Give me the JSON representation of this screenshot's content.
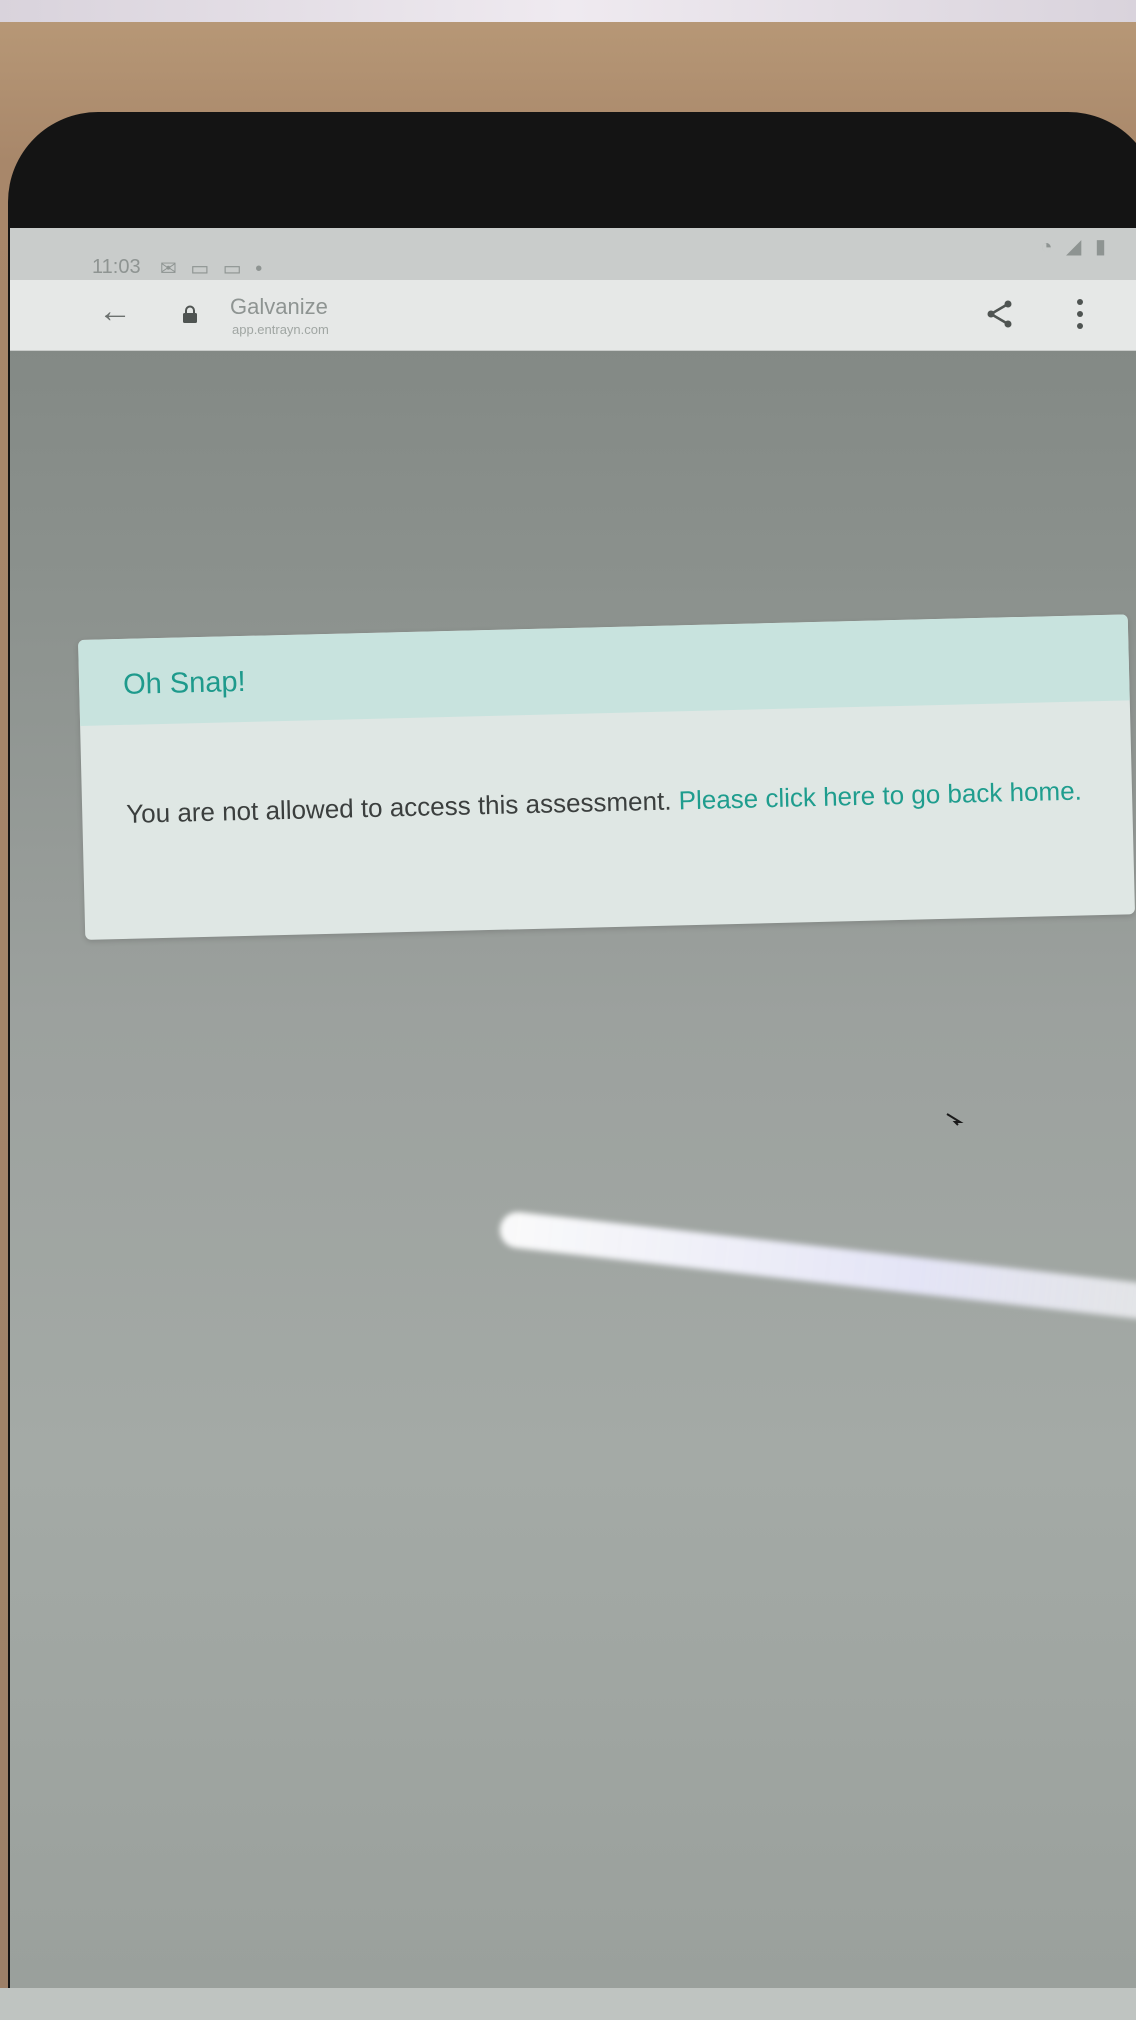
{
  "status_bar": {
    "time": "11:03",
    "left_icons": "✉ ▭ ▭ •",
    "right_icons": "◔ ◢ ▮"
  },
  "browser": {
    "site_title": "Galvanize",
    "site_url": "app.entrayn.com",
    "back_icon": "back-arrow-icon",
    "share_icon": "share-icon",
    "menu_icon": "more-vertical-icon"
  },
  "dialog": {
    "title": "Oh Snap!",
    "message": "You are not allowed to access this assessment.",
    "link_text": "Please click here to go back home."
  },
  "colors": {
    "accent": "#1f9d8e",
    "dialog_header_bg": "#c8e3de",
    "dialog_bg": "#dfe7e4",
    "overlay": "#8b918d"
  }
}
